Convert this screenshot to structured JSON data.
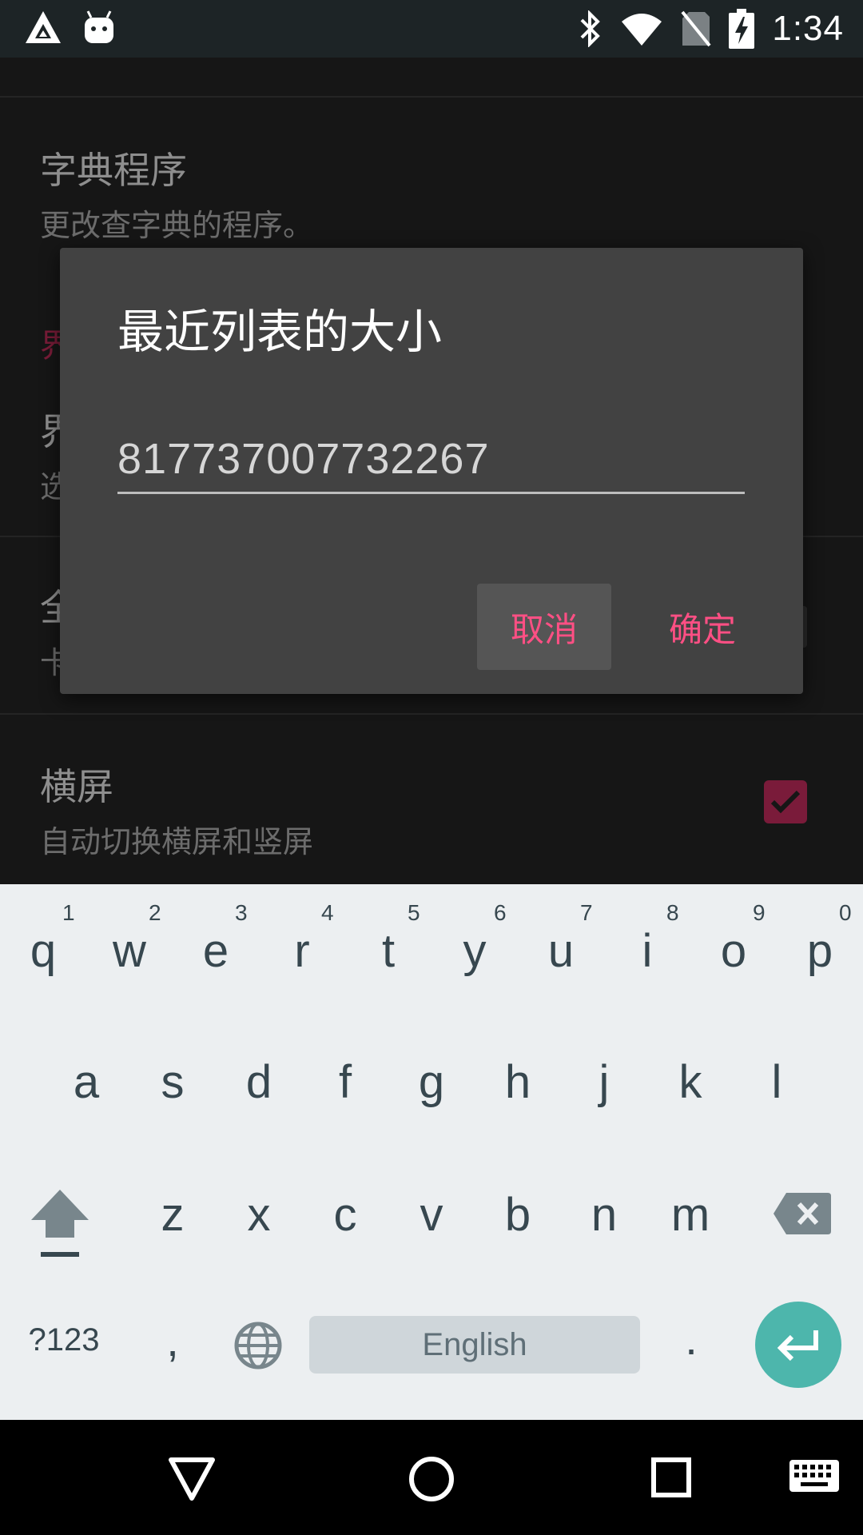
{
  "status_bar": {
    "time": "1:34",
    "icons": [
      "notification-triangle-icon",
      "android-icon",
      "bluetooth-icon",
      "wifi-icon",
      "no-sim-icon",
      "battery-charging-icon"
    ]
  },
  "settings": {
    "dictionary_title": "字典程序",
    "dictionary_summary": "更改查字典的程序。",
    "category_partial": "界",
    "interface_partial_title": "界",
    "interface_partial_summary": "选",
    "fullscreen_partial_title": "全",
    "fullscreen_partial_summary": "卡",
    "landscape_title": "横屏",
    "landscape_summary": "自动切换横屏和竖屏",
    "landscape_checked": true,
    "accent_color": "#7a1b3a"
  },
  "dialog": {
    "title": "最近列表的大小",
    "input_value": "817737007732267",
    "cancel_label": "取消",
    "ok_label": "确定",
    "button_color": "#ff4f84"
  },
  "keyboard": {
    "row1": [
      "q",
      "w",
      "e",
      "r",
      "t",
      "y",
      "u",
      "i",
      "o",
      "p"
    ],
    "row1_hints": [
      "1",
      "2",
      "3",
      "4",
      "5",
      "6",
      "7",
      "8",
      "9",
      "0"
    ],
    "row2": [
      "a",
      "s",
      "d",
      "f",
      "g",
      "h",
      "j",
      "k",
      "l"
    ],
    "row3": [
      "z",
      "x",
      "c",
      "v",
      "b",
      "n",
      "m"
    ],
    "symbols_label": "?123",
    "comma_label": ",",
    "period_label": ".",
    "space_label": "English",
    "enter_color": "#4db6ac"
  },
  "nav_bar": {
    "icons": [
      "back-icon",
      "home-icon",
      "recents-icon",
      "keyboard-icon"
    ]
  }
}
